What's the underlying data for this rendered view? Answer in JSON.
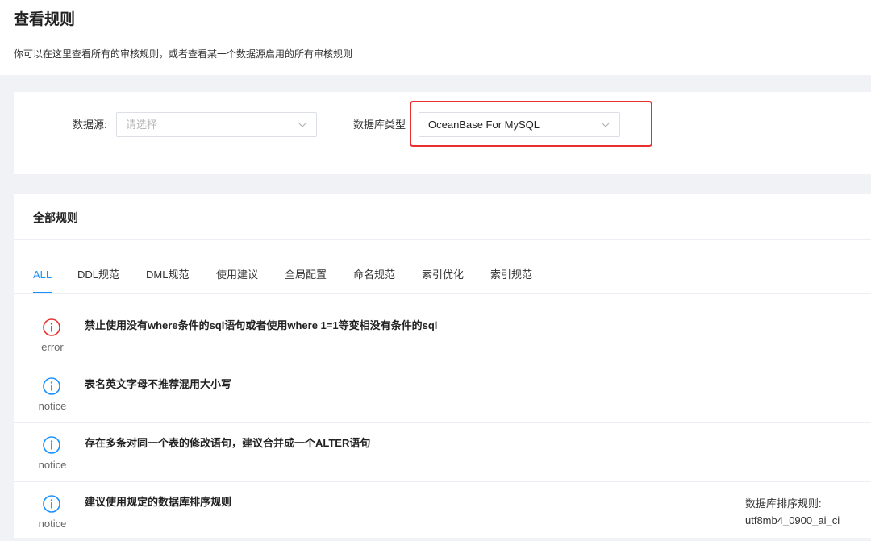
{
  "header": {
    "title": "查看规则",
    "description": "你可以在这里查看所有的审核规则，或者查看某一个数据源启用的所有审核规则"
  },
  "filters": {
    "datasource_label": "数据源:",
    "datasource_placeholder": "请选择",
    "dbtype_label": "数据库类型",
    "dbtype_value": "OceanBase For MySQL"
  },
  "rules": {
    "title": "全部规则",
    "tabs": [
      "ALL",
      "DDL规范",
      "DML规范",
      "使用建议",
      "全局配置",
      "命名规范",
      "索引优化",
      "索引规范"
    ],
    "active_tab": "ALL",
    "items": [
      {
        "level": "error",
        "icon": "error-circle-icon",
        "description": "禁止使用没有where条件的sql语句或者使用where 1=1等变相没有条件的sql"
      },
      {
        "level": "notice",
        "icon": "info-circle-icon",
        "description": "表名英文字母不推荐混用大小写"
      },
      {
        "level": "notice",
        "icon": "info-circle-icon",
        "description": "存在多条对同一个表的修改语句，建议合并成一个ALTER语句"
      },
      {
        "level": "notice",
        "icon": "info-circle-icon",
        "description": "建议使用规定的数据库排序规则",
        "extra_label": "数据库排序规则:",
        "extra_value": "utf8mb4_0900_ai_ci"
      }
    ]
  },
  "colors": {
    "primary": "#1890ff",
    "error": "#e8302f",
    "highlight": "#e8302f"
  }
}
